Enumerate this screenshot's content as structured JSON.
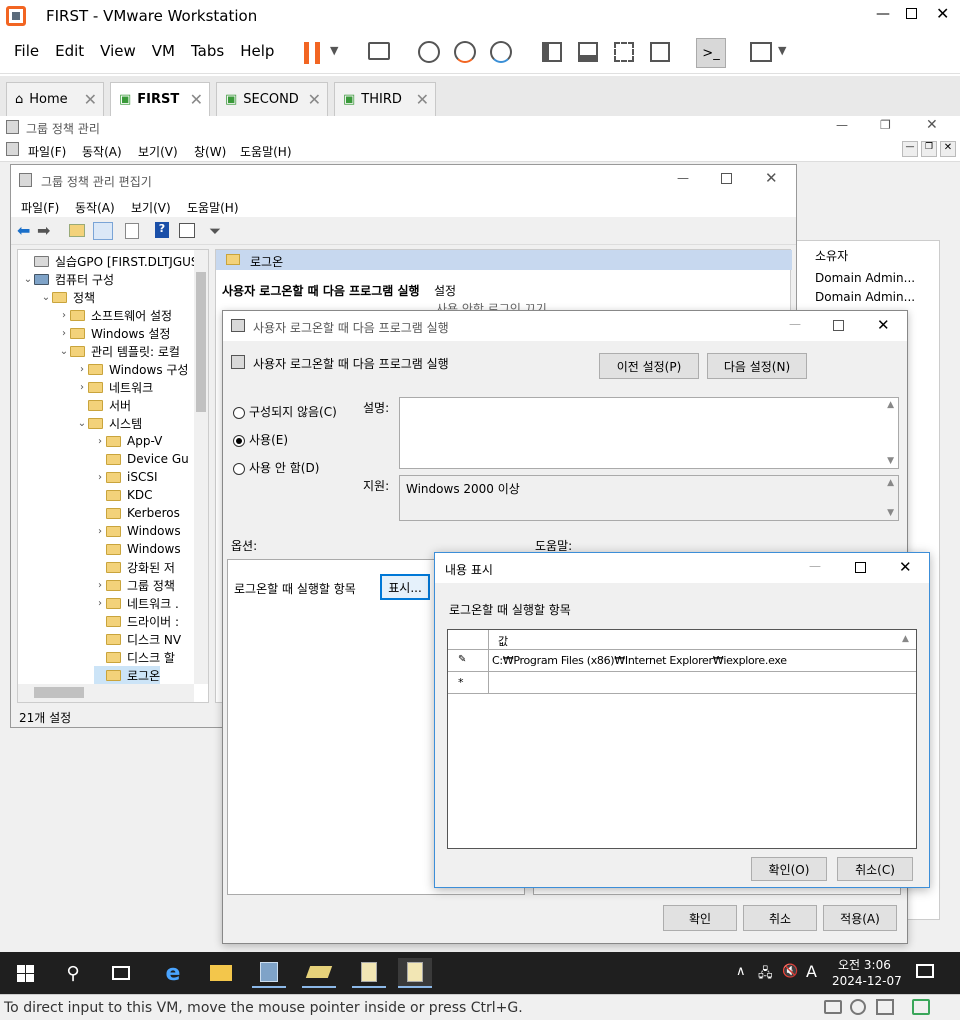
{
  "vmware": {
    "title": "FIRST - VMware Workstation",
    "menu": [
      "File",
      "Edit",
      "View",
      "VM",
      "Tabs",
      "Help"
    ],
    "tabs": [
      {
        "label": "Home"
      },
      {
        "label": "FIRST"
      },
      {
        "label": "SECOND"
      },
      {
        "label": "THIRD"
      }
    ],
    "status_text": "To direct input to this VM, move the mouse pointer inside or press Ctrl+G."
  },
  "gpmc": {
    "title": "그룹 정책 관리",
    "menu": [
      "파일(F)",
      "동작(A)",
      "보기(V)",
      "창(W)",
      "도움말(H)"
    ],
    "owner_header": "소유자",
    "owners": [
      "Domain Admin...",
      "Domain Admin..."
    ]
  },
  "gpme": {
    "title": "그룹 정책 관리 편집기",
    "menu": [
      "파일(F)",
      "동작(A)",
      "보기(V)",
      "도움말(H)"
    ],
    "tree": [
      {
        "label": "실습GPO [FIRST.DLTJGUS.CO",
        "level": 0
      },
      {
        "label": "컴퓨터 구성",
        "level": 0
      },
      {
        "label": "정책",
        "level": 1
      },
      {
        "label": "소프트웨어 설정",
        "level": 2
      },
      {
        "label": "Windows 설정",
        "level": 2
      },
      {
        "label": "관리 템플릿: 로컬",
        "level": 2
      },
      {
        "label": "Windows 구성",
        "level": 3
      },
      {
        "label": "네트워크",
        "level": 3
      },
      {
        "label": "서버",
        "level": 3
      },
      {
        "label": "시스템",
        "level": 3
      },
      {
        "label": "App-V",
        "level": 4
      },
      {
        "label": "Device Gu",
        "level": 4
      },
      {
        "label": "iSCSI",
        "level": 4
      },
      {
        "label": "KDC",
        "level": 4
      },
      {
        "label": "Kerberos",
        "level": 4
      },
      {
        "label": "Windows",
        "level": 4
      },
      {
        "label": "Windows",
        "level": 4
      },
      {
        "label": "강화된 저",
        "level": 4
      },
      {
        "label": "그룹 정책",
        "level": 4
      },
      {
        "label": "네트워크 .",
        "level": 4
      },
      {
        "label": "드라이버 :",
        "level": 4
      },
      {
        "label": "디스크 NV",
        "level": 4
      },
      {
        "label": "디스크 할",
        "level": 4
      },
      {
        "label": "로그온",
        "level": 4
      }
    ],
    "status": "21개 설정",
    "pane_header": "로그온",
    "policy_title": "사용자 로그온할 때 다음 프로그램 실행",
    "settings_header": "설정",
    "settings_item": "사용 안함 로그인 끄기"
  },
  "policy_dialog": {
    "title": "사용자 로그온할 때 다음 프로그램 실행",
    "heading": "사용자 로그온할 때 다음 프로그램 실행",
    "prev_button": "이전 설정(P)",
    "next_button": "다음 설정(N)",
    "radio_not_configured": "구성되지 않음(C)",
    "radio_enabled": "사용(E)",
    "radio_disabled": "사용 안 함(D)",
    "comment_label": "설명:",
    "supported_label": "지원:",
    "supported_value": "Windows 2000 이상",
    "options_label": "옵션:",
    "help_label": "도움말:",
    "option_item_label": "로그온할 때 실행할 항목",
    "show_button": "표시...",
    "ok": "확인",
    "cancel": "취소",
    "apply": "적용(A)"
  },
  "show_dialog": {
    "title": "내용 표시",
    "label": "로그온할 때 실행할 항목",
    "col_header": "값",
    "row_value": "C:₩Program Files (x86)₩Internet Explorer₩iexplore.exe",
    "ok": "확인(O)",
    "cancel": "취소(C)"
  },
  "taskbar": {
    "time": "오전 3:06",
    "date": "2024-12-07",
    "ime": "A"
  },
  "colors": {
    "accent": "#0078d7",
    "vm_orange": "#f26522",
    "taskbar": "#1f1f1f"
  }
}
